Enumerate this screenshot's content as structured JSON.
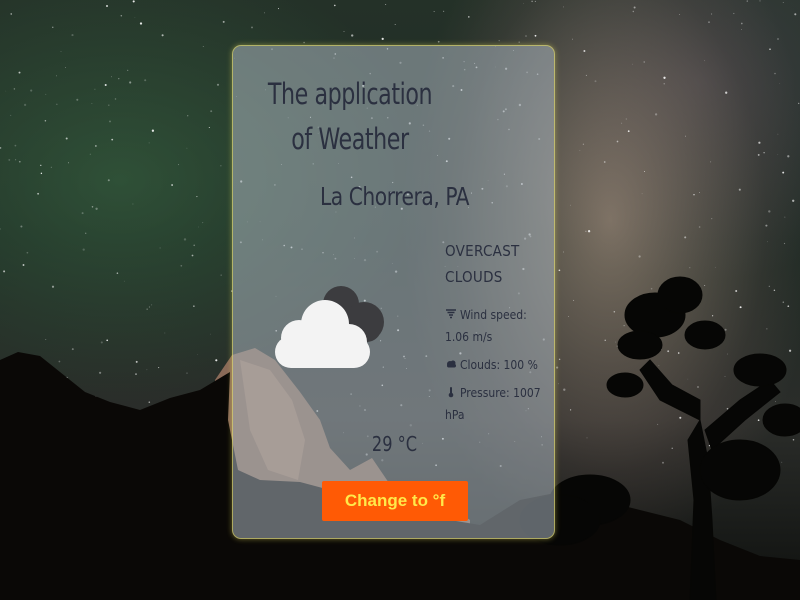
{
  "app": {
    "title": "The application of Weather",
    "location": "La Chorrera, PA",
    "weather": {
      "icon": "cloud-icon",
      "description": "OVERCAST CLOUDS",
      "wind_label": "Wind speed:",
      "wind_value": "1.06 m/s",
      "clouds_label": "Clouds:",
      "clouds_value": "100 %",
      "pressure_label": "Pressure:",
      "pressure_value": "1007 hPa",
      "temperature": "29 °C"
    },
    "toggle_button_label": "Change to °f"
  },
  "colors": {
    "card_border": "#ebe15a",
    "text": "#2b3040",
    "button_bg": "#ff5a05",
    "button_text": "#ffe94a"
  }
}
